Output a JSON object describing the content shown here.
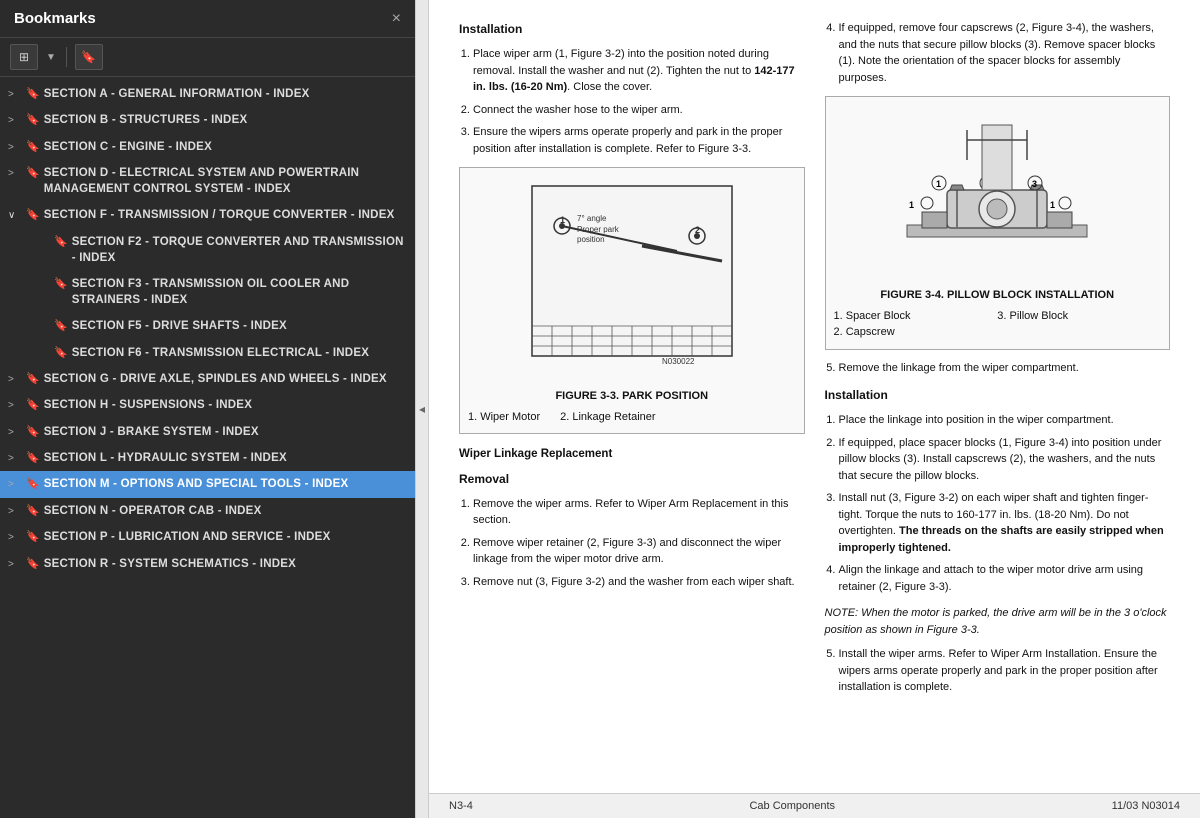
{
  "sidebar": {
    "title": "Bookmarks",
    "close_label": "×",
    "toolbar": {
      "grid_icon": "⊞",
      "bookmark_icon": "🔖"
    },
    "items": [
      {
        "id": "section-a",
        "label": "SECTION A - GENERAL INFORMATION - INDEX",
        "level": 0,
        "expanded": false,
        "active": false,
        "has_children": false
      },
      {
        "id": "section-b",
        "label": "SECTION B - STRUCTURES - INDEX",
        "level": 0,
        "expanded": false,
        "active": false,
        "has_children": false
      },
      {
        "id": "section-c",
        "label": "SECTION C - ENGINE - INDEX",
        "level": 0,
        "expanded": false,
        "active": false,
        "has_children": false
      },
      {
        "id": "section-d",
        "label": "SECTION D - ELECTRICAL SYSTEM AND POWERTRAIN MANAGEMENT CONTROL SYSTEM - INDEX",
        "level": 0,
        "expanded": false,
        "active": false,
        "has_children": false
      },
      {
        "id": "section-f",
        "label": "SECTION F - TRANSMISSION / TORQUE CONVERTER - INDEX",
        "level": 0,
        "expanded": true,
        "active": false,
        "has_children": true
      },
      {
        "id": "section-f2",
        "label": "SECTION F2 - TORQUE CONVERTER AND TRANSMISSION - INDEX",
        "level": 1,
        "expanded": false,
        "active": false,
        "has_children": false
      },
      {
        "id": "section-f3",
        "label": "SECTION F3 - TRANSMISSION OIL COOLER AND STRAINERS - INDEX",
        "level": 1,
        "expanded": false,
        "active": false,
        "has_children": false
      },
      {
        "id": "section-f5",
        "label": "SECTION F5 - DRIVE SHAFTS - INDEX",
        "level": 1,
        "expanded": false,
        "active": false,
        "has_children": false
      },
      {
        "id": "section-f6",
        "label": "SECTION F6 - TRANSMISSION ELECTRICAL - INDEX",
        "level": 1,
        "expanded": false,
        "active": false,
        "has_children": false
      },
      {
        "id": "section-g",
        "label": "SECTION G - DRIVE AXLE, SPINDLES AND WHEELS - INDEX",
        "level": 0,
        "expanded": false,
        "active": false,
        "has_children": false
      },
      {
        "id": "section-h",
        "label": "SECTION H - SUSPENSIONS - INDEX",
        "level": 0,
        "expanded": false,
        "active": false,
        "has_children": false
      },
      {
        "id": "section-j",
        "label": "SECTION J - BRAKE SYSTEM - INDEX",
        "level": 0,
        "expanded": false,
        "active": false,
        "has_children": false
      },
      {
        "id": "section-l",
        "label": "SECTION L - HYDRAULIC SYSTEM - INDEX",
        "level": 0,
        "expanded": false,
        "active": false,
        "has_children": false
      },
      {
        "id": "section-m",
        "label": "SECTION M - OPTIONS AND SPECIAL TOOLS - INDEX",
        "level": 0,
        "expanded": false,
        "active": true,
        "has_children": false
      },
      {
        "id": "section-n",
        "label": "SECTION N - OPERATOR CAB - INDEX",
        "level": 0,
        "expanded": false,
        "active": false,
        "has_children": false
      },
      {
        "id": "section-p",
        "label": "SECTION P - LUBRICATION AND SERVICE - INDEX",
        "level": 0,
        "expanded": false,
        "active": false,
        "has_children": false
      },
      {
        "id": "section-r",
        "label": "SECTION R - SYSTEM SCHEMATICS - INDEX",
        "level": 0,
        "expanded": false,
        "active": false,
        "has_children": false
      }
    ]
  },
  "main": {
    "content": {
      "installation_title": "Installation",
      "left_col": {
        "steps": [
          "Place wiper arm (1, Figure 3-2) into the position noted during removal. Install the washer and nut (2). Tighten the nut to 142-177 in. lbs. (16-20 Nm). Close the cover.",
          "Connect the washer hose to the wiper arm.",
          "Ensure the wipers arms operate properly and park in the proper position after installation is complete. Refer to Figure 3-3."
        ],
        "figure_id": "N030022",
        "figure_caption": "FIGURE 3-3. PARK POSITION",
        "figure_items": [
          "1. Wiper Motor",
          "2. Linkage Retainer"
        ],
        "sub_section": "Wiper Linkage Replacement",
        "removal_title": "Removal",
        "removal_steps": [
          "Remove the wiper arms. Refer to Wiper Arm Replacement in this section.",
          "Remove wiper retainer (2, Figure 3-3) and disconnect the wiper linkage from the wiper motor drive arm.",
          "Remove nut (3, Figure 3-2) and the washer from each wiper shaft."
        ]
      },
      "right_col": {
        "step4": "If equipped, remove four capscrews (2, Figure 3-4), the washers, and the nuts that secure pillow blocks (3). Remove spacer blocks (1). Note the orientation of the spacer blocks for assembly purposes.",
        "figure_caption": "FIGURE 3-4. PILLOW BLOCK INSTALLATION",
        "figure_items": [
          "1. Spacer Block",
          "3. Pillow Block",
          "2. Capscrew"
        ],
        "step5": "Remove the linkage from the wiper compartment.",
        "installation_title": "Installation",
        "installation_steps": [
          "Place the linkage into position in the wiper compartment.",
          "If equipped, place spacer blocks (1, Figure 3-4) into position under pillow blocks (3). Install capscrews (2), the washers, and the nuts that secure the pillow blocks.",
          "Install nut (3, Figure 3-2) on each wiper shaft and tighten finger-tight. Torque the nuts to 160-177 in. lbs. (18-20 Nm). Do not overtighten. The threads on the shafts are easily stripped when improperly tightened.",
          "Align the linkage and attach to the wiper motor drive arm using retainer (2, Figure 3-3)."
        ],
        "note": "NOTE: When the motor is parked, the drive arm will be in the 3 o'clock position as shown in Figure 3-3.",
        "step5b": "Install the wiper arms. Refer to Wiper Arm Installation. Ensure the wipers arms operate properly and park in the proper position after installation is complete."
      }
    },
    "footer": {
      "page": "N3-4",
      "section": "Cab Components",
      "date_doc": "11/03  N03014"
    }
  }
}
